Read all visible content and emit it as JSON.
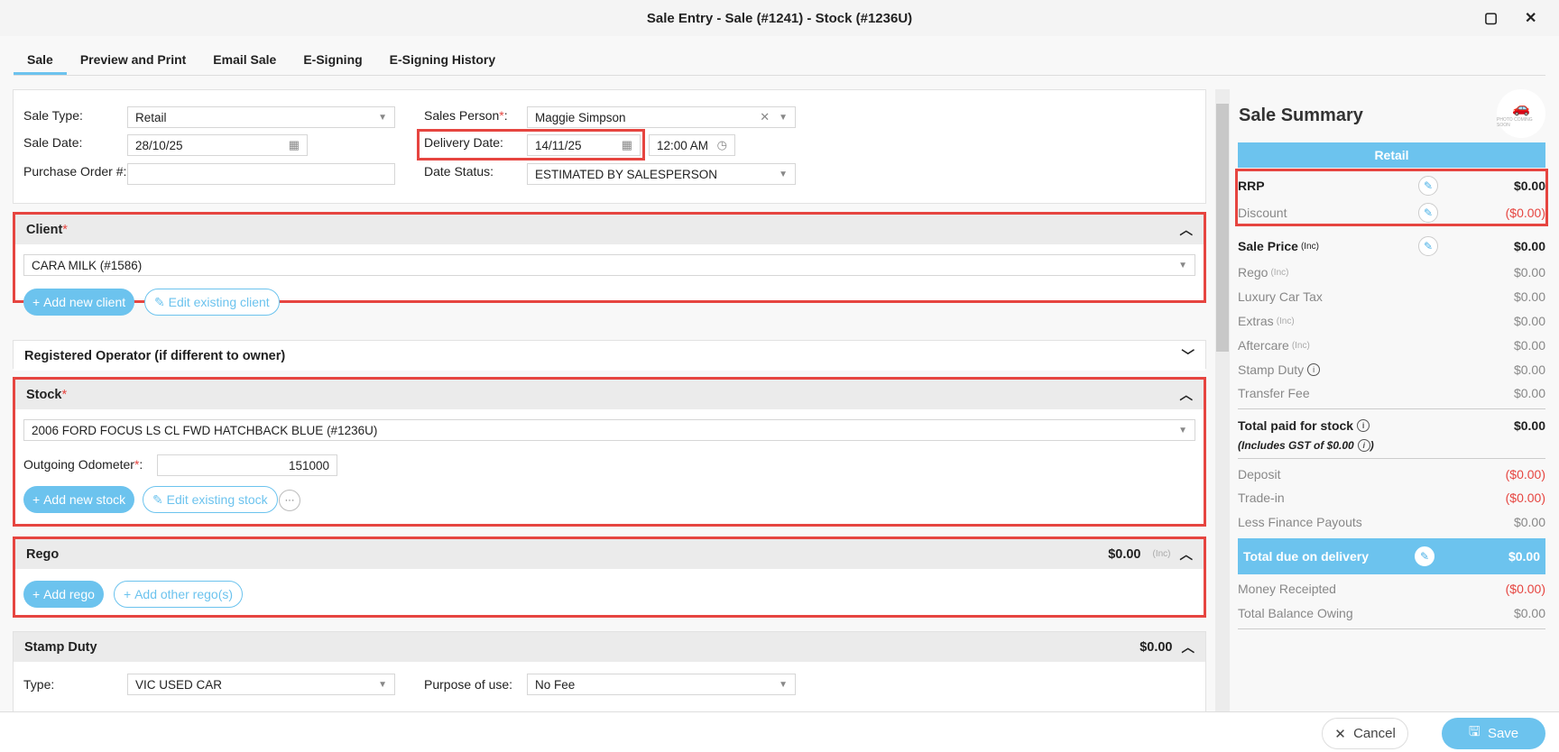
{
  "window": {
    "title": "Sale Entry - Sale (#1241) - Stock (#1236U)",
    "maximize": "▢",
    "close": "✕"
  },
  "tabs": [
    "Sale",
    "Preview and Print",
    "Email Sale",
    "E-Signing",
    "E-Signing History"
  ],
  "header": {
    "sale_type_label": "Sale Type:",
    "sale_type": "Retail",
    "sale_date_label": "Sale Date:",
    "sale_date": "28/10/25",
    "po_label": "Purchase Order #:",
    "po_value": "",
    "sales_person_label": "Sales Person",
    "sales_person": "Maggie Simpson",
    "delivery_date_label": "Delivery Date:",
    "delivery_date": "14/11/25",
    "delivery_time": "12:00 AM",
    "date_status_label": "Date Status:",
    "date_status": "ESTIMATED BY SALESPERSON"
  },
  "client": {
    "title": "Client",
    "value": "CARA MILK (#1586)",
    "add": "Add new client",
    "edit": "Edit existing client"
  },
  "operator": {
    "title": "Registered Operator (if different to owner)"
  },
  "stock": {
    "title": "Stock",
    "value": "2006 FORD FOCUS LS CL FWD HATCHBACK BLUE (#1236U)",
    "odo_label": "Outgoing Odometer",
    "odo": "151000",
    "add": "Add new stock",
    "edit": "Edit existing stock",
    "more": "···"
  },
  "rego": {
    "title": "Rego",
    "amount": "$0.00",
    "inc": "(Inc)",
    "add": "Add rego",
    "add_other": "Add other rego(s)"
  },
  "stamp": {
    "title": "Stamp Duty",
    "amount": "$0.00",
    "type_label": "Type:",
    "type": "VIC USED CAR",
    "purpose_label": "Purpose of use:",
    "purpose": "No Fee"
  },
  "summary": {
    "title": "Sale Summary",
    "photo": "PHOTO COMING SOON",
    "sale_type": "Retail",
    "inc": "(Inc)",
    "rrp": {
      "label": "RRP",
      "value": "$0.00"
    },
    "discount": {
      "label": "Discount",
      "value": "($0.00)"
    },
    "sale_price": {
      "label": "Sale Price",
      "value": "$0.00"
    },
    "rego": {
      "label": "Rego",
      "value": "$0.00"
    },
    "lct": {
      "label": "Luxury Car Tax",
      "value": "$0.00"
    },
    "extras": {
      "label": "Extras",
      "value": "$0.00"
    },
    "aftercare": {
      "label": "Aftercare",
      "value": "$0.00"
    },
    "stamp": {
      "label": "Stamp Duty",
      "value": "$0.00"
    },
    "transfer": {
      "label": "Transfer Fee",
      "value": "$0.00"
    },
    "total_paid": {
      "label": "Total paid for stock",
      "value": "$0.00"
    },
    "gst": "(Includes GST of $0.00",
    "deposit": {
      "label": "Deposit",
      "value": "($0.00)"
    },
    "tradein": {
      "label": "Trade-in",
      "value": "($0.00)"
    },
    "finance": {
      "label": "Less Finance Payouts",
      "value": "$0.00"
    },
    "total_due": {
      "label": "Total due on delivery",
      "value": "$0.00"
    },
    "receipted": {
      "label": "Money Receipted",
      "value": "($0.00)"
    },
    "balance": {
      "label": "Total Balance Owing",
      "value": "$0.00"
    }
  },
  "footer": {
    "cancel": "Cancel",
    "save": "Save"
  },
  "colors": {
    "accent": "#6cc3ee",
    "highlight": "#e64540"
  }
}
